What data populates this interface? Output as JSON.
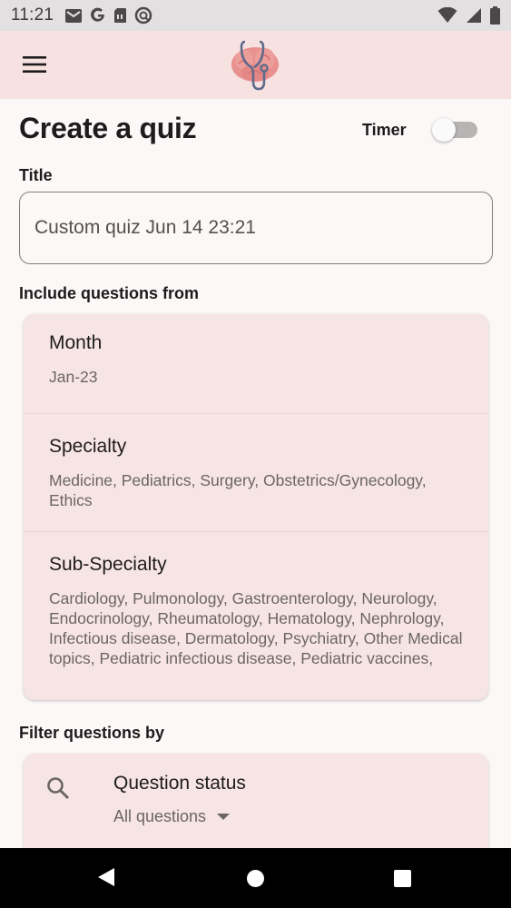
{
  "status_bar": {
    "time": "11:21",
    "left_icons": [
      "gmail-icon",
      "google-icon",
      "sim-card-icon",
      "do-not-disturb-icon"
    ],
    "right_icons": [
      "wifi-icon",
      "signal-icon",
      "battery-icon"
    ]
  },
  "app_bar": {
    "menu_icon": "hamburger-menu-icon",
    "logo": "brain-stethoscope-logo"
  },
  "page": {
    "title": "Create a quiz",
    "timer_label": "Timer",
    "timer_on": false
  },
  "title_section": {
    "label": "Title",
    "value": "Custom quiz Jun 14 23:21"
  },
  "include_section": {
    "label": "Include questions from",
    "items": [
      {
        "title": "Month",
        "value": "Jan-23"
      },
      {
        "title": "Specialty",
        "value": "Medicine, Pediatrics, Surgery, Obstetrics/Gynecology, Ethics"
      },
      {
        "title": "Sub-Specialty",
        "value": "Cardiology, Pulmonology, Gastroenterology, Neurology, Endocrinology, Rheumatology, Hematology, Nephrology, Infectious disease, Dermatology, Psychiatry, Other Medical topics, Pediatric infectious disease, Pediatric vaccines,"
      }
    ]
  },
  "filter_section": {
    "label": "Filter questions by",
    "status_title": "Question status",
    "status_value": "All questions"
  },
  "colors": {
    "app_bar_bg": "#f7e1e1",
    "card_bg": "#f7e5e5",
    "page_bg": "#fdf8f8",
    "logo_pink": "#e8918f",
    "logo_blue": "#5f6b8c"
  }
}
